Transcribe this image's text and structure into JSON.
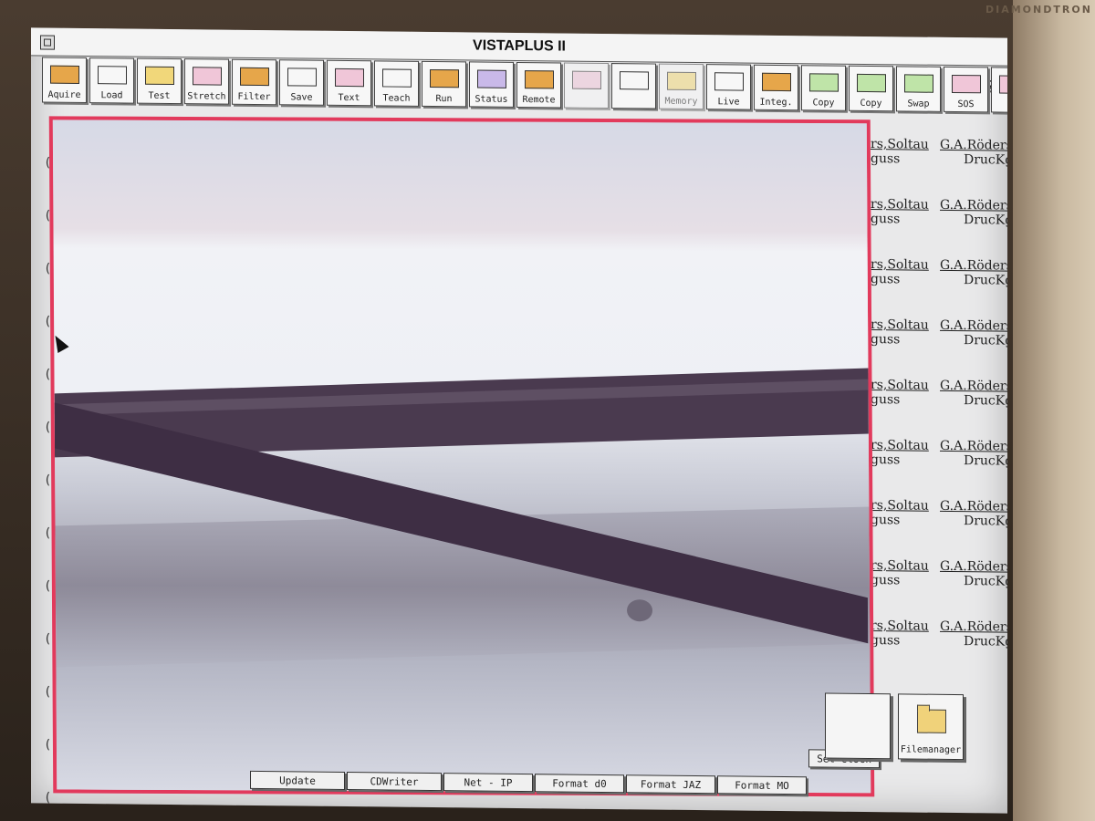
{
  "window": {
    "title": "VISTAPLUS II",
    "help_glyph": "?"
  },
  "monitor": {
    "brand": "DIAMONDTRON"
  },
  "toolbar": [
    {
      "label": "Aquire",
      "icon": "acquire-icon"
    },
    {
      "label": "Load",
      "icon": "load-icon"
    },
    {
      "label": "Test",
      "icon": "test-icon"
    },
    {
      "label": "Stretch",
      "icon": "stretch-icon"
    },
    {
      "label": "Filter",
      "icon": "filter-icon"
    },
    {
      "label": "Save",
      "icon": "save-icon"
    },
    {
      "label": "Text",
      "icon": "text-icon"
    },
    {
      "label": "Teach",
      "icon": "teach-icon"
    },
    {
      "label": "Run",
      "icon": "run-icon"
    },
    {
      "label": "Status",
      "icon": "status-icon"
    },
    {
      "label": "Remote",
      "icon": "remote-icon"
    },
    {
      "label": "",
      "icon": "histogram-icon"
    },
    {
      "label": "",
      "icon": "undo-icon"
    },
    {
      "label": "Memory",
      "icon": "memory-icon"
    },
    {
      "label": "Live",
      "icon": "live-icon"
    },
    {
      "label": "Integ.",
      "icon": "integrate-icon"
    },
    {
      "label": "Copy",
      "icon": "copy-down-icon"
    },
    {
      "label": "Copy",
      "icon": "copy-up-icon"
    },
    {
      "label": "Swap",
      "icon": "swap-icon"
    },
    {
      "label": "SOS",
      "icon": "sos-lifebuoy-icon"
    },
    {
      "label": "",
      "icon": "sader-panel-icon"
    }
  ],
  "listing": {
    "col_a": [
      {
        "l1": "rs,Soltau",
        "l2": "guss"
      },
      {
        "l1": "rs,Soltau",
        "l2": "guss"
      },
      {
        "l1": "rs,Soltau",
        "l2": "guss"
      },
      {
        "l1": "rs,Soltau",
        "l2": "guss"
      },
      {
        "l1": "rs,Soltau",
        "l2": "guss"
      },
      {
        "l1": "rs,Soltau",
        "l2": "guss"
      },
      {
        "l1": "rs,Soltau",
        "l2": "guss"
      },
      {
        "l1": "rs,Soltau",
        "l2": "guss"
      },
      {
        "l1": "rs,Soltau",
        "l2": "guss"
      }
    ],
    "col_b": [
      {
        "l1": "G.A.Röders,S",
        "l2": "DrucKguss"
      },
      {
        "l1": "G.A.Röders,S",
        "l2": "DrucKguss"
      },
      {
        "l1": "G.A.Röders,S",
        "l2": "DrucKguss"
      },
      {
        "l1": "G.A.Röders,S",
        "l2": "DrucKguss"
      },
      {
        "l1": "G.A.Röders,S",
        "l2": "DrucKguss"
      },
      {
        "l1": "G.A.Röders,S",
        "l2": "DrucKguss"
      },
      {
        "l1": "G.A.Röders,S",
        "l2": "DrucKguss"
      },
      {
        "l1": "G.A.Röders,S",
        "l2": "DrucKguss"
      },
      {
        "l1": "G.A.Röders,S",
        "l2": "DrucKguss"
      }
    ]
  },
  "left_marks": [
    "(",
    "(",
    "(",
    "(",
    "(",
    "(",
    "(",
    "(",
    "(",
    "(",
    "(",
    "(",
    "("
  ],
  "bottom_buttons": [
    "Update",
    "CDWriter",
    "Net - IP",
    "Format d0",
    "Format JAZ",
    "Format MO",
    "Set clock"
  ],
  "big_buttons": [
    {
      "label": "",
      "icon": "blank-icon"
    },
    {
      "label": "Filemanager",
      "icon": "folder-icon"
    }
  ],
  "image_view": {
    "frame_color": "#e23a5c"
  }
}
